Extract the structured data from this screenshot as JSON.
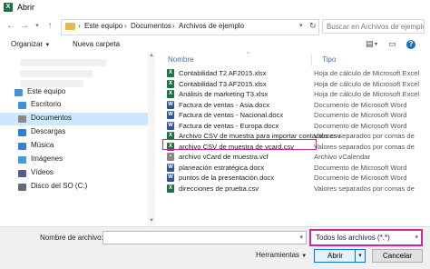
{
  "window": {
    "title": "Abrir"
  },
  "nav": {
    "breadcrumb": [
      "Este equipo",
      "Documentos",
      "Archivos de ejemplo"
    ],
    "search_placeholder": "Buscar en Archivos de ejemplo"
  },
  "toolbar": {
    "organize": "Organizar",
    "new_folder": "Nueva carpeta"
  },
  "sidebar": {
    "this_pc": "Este equipo",
    "items": [
      {
        "label": "Escritorio",
        "icon": "desktop-icon",
        "color": "#3c8fd8"
      },
      {
        "label": "Documentos",
        "icon": "documents-icon",
        "color": "#8a8a8a",
        "selected": true
      },
      {
        "label": "Descargas",
        "icon": "downloads-icon",
        "color": "#2f7fcf"
      },
      {
        "label": "Música",
        "icon": "music-icon",
        "color": "#3a7ec9"
      },
      {
        "label": "Imágenes",
        "icon": "pictures-icon",
        "color": "#4b98d6"
      },
      {
        "label": "Vídeos",
        "icon": "videos-icon",
        "color": "#5a5a8f"
      },
      {
        "label": "Disco del SO (C:)",
        "icon": "drive-icon",
        "color": "#5f6b78"
      }
    ]
  },
  "list": {
    "columns": {
      "name": "Nombre",
      "type": "Tipo"
    },
    "files": [
      {
        "name": "Contabilidad T2 AF2015.xlsx",
        "type": "Hoja de cálculo de Microsoft Excel",
        "kind": "xl"
      },
      {
        "name": "Contabilidad T3 AF2015.xlsx",
        "type": "Hoja de cálculo de Microsoft Excel",
        "kind": "xl"
      },
      {
        "name": "Análisis de marketing T3.xlsx",
        "type": "Hoja de cálculo de Microsoft Excel",
        "kind": "xl"
      },
      {
        "name": "Factura de ventas - Asia.docx",
        "type": "Documento de Microsoft Word",
        "kind": "wd"
      },
      {
        "name": "Factura de ventas - Nacional.docx",
        "type": "Documento de Microsoft Word",
        "kind": "wd"
      },
      {
        "name": "Factura de ventas - Europa.docx",
        "type": "Documento de Microsoft Word",
        "kind": "wd"
      },
      {
        "name": "Archivo CSV de muestra para importar contactos.csv",
        "type": "Valores separados por comas de",
        "kind": "xl",
        "highlighted": true
      },
      {
        "name": "archivo CSV de muestra de vcard.csv",
        "type": "Valores separados por comas de",
        "kind": "xl"
      },
      {
        "name": "archivo vCard de muestra.vcf",
        "type": "Archivo vCalendar",
        "kind": "vc"
      },
      {
        "name": "planeación estratégica.docx",
        "type": "Documento de Microsoft Word",
        "kind": "wd"
      },
      {
        "name": "puntos de la presentación.docx",
        "type": "Documento de Microsoft Word",
        "kind": "wd"
      },
      {
        "name": "direcciones de prueba.csv",
        "type": "Valores separados por comas de",
        "kind": "xl"
      }
    ]
  },
  "bottom": {
    "filename_label": "Nombre de archivo:",
    "filename_value": "",
    "filter_value": "Todos los archivos (*.*)",
    "tools_label": "Herramientas",
    "open_label": "Abrir",
    "cancel_label": "Cancelar"
  },
  "colors": {
    "highlight": "#cc2a9c",
    "selection": "#cce8ff",
    "accent": "#0078d7"
  }
}
